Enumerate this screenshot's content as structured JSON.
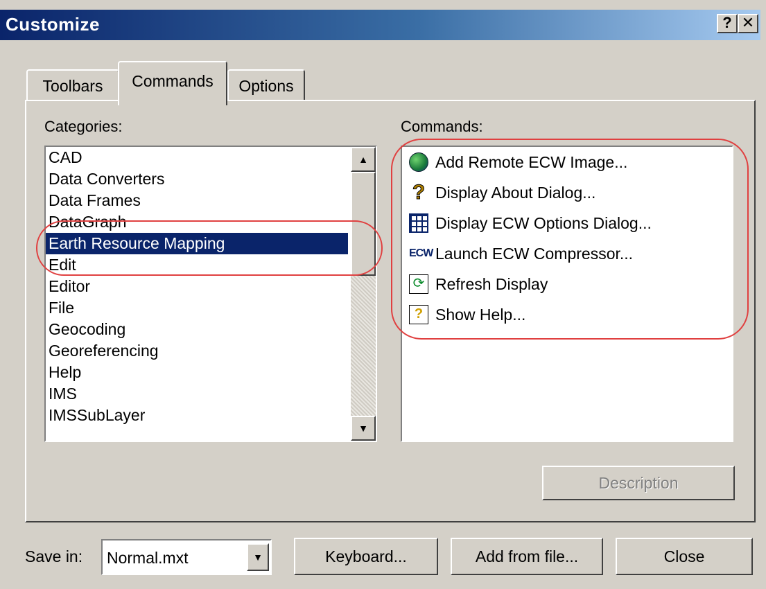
{
  "window": {
    "title": "Customize",
    "help_glyph": "?",
    "close_glyph": "✕"
  },
  "tabs": [
    {
      "label": "Toolbars",
      "active": false
    },
    {
      "label": "Commands",
      "active": true
    },
    {
      "label": "Options",
      "active": false
    }
  ],
  "categories": {
    "label": "Categories:",
    "items": [
      "CAD",
      "Data Converters",
      "Data Frames",
      "DataGraph",
      "Earth Resource Mapping",
      "Edit",
      "Editor",
      "File",
      "Geocoding",
      "Georeferencing",
      "Help",
      "IMS",
      "IMSSubLayer"
    ],
    "selected": "Earth Resource Mapping"
  },
  "commands": {
    "label": "Commands:",
    "items": [
      {
        "label": "Add Remote ECW Image...",
        "icon": "globe-icon"
      },
      {
        "label": "Display About Dialog...",
        "icon": "question-mark-icon"
      },
      {
        "label": "Display ECW Options Dialog...",
        "icon": "options-grid-icon"
      },
      {
        "label": "Launch ECW Compressor...",
        "icon": "ecw-compressor-icon"
      },
      {
        "label": "Refresh Display",
        "icon": "refresh-icon"
      },
      {
        "label": "Show Help...",
        "icon": "help-document-icon"
      }
    ]
  },
  "buttons": {
    "description": "Description",
    "keyboard": "Keyboard...",
    "add_from_file": "Add from file...",
    "close": "Close"
  },
  "save_in": {
    "label": "Save in:",
    "value": "Normal.mxt"
  },
  "icons": {
    "scroll_up": "▲",
    "scroll_down": "▼",
    "dropdown": "▼",
    "question": "?",
    "ecw": "ECW",
    "refresh": "⟳",
    "help_doc": "?"
  },
  "colors": {
    "title_gradient_start": "#0a246a",
    "selection": "#0a246a",
    "highlight_ring": "#e04040",
    "face": "#d4d0c8"
  }
}
